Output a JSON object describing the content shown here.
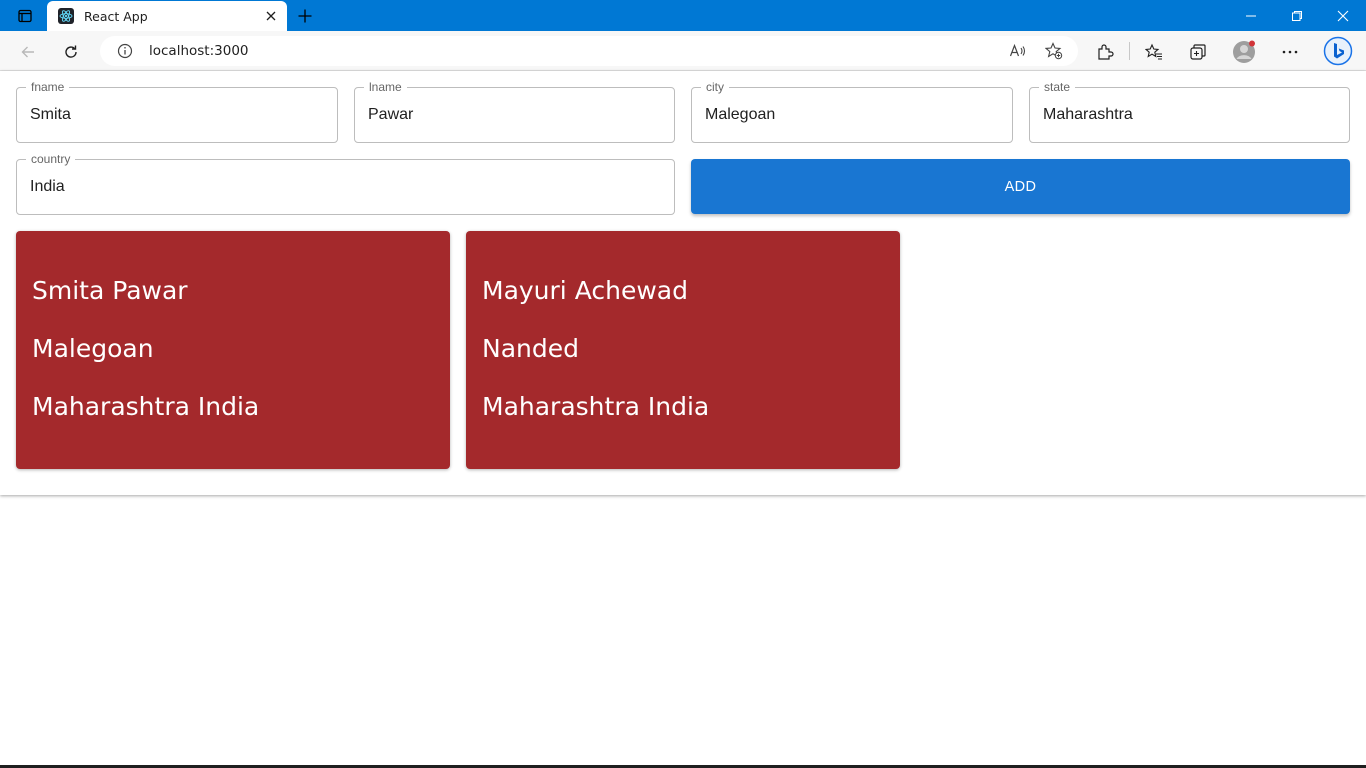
{
  "browser": {
    "tab_title": "React App",
    "url": "localhost:3000"
  },
  "form": {
    "fname": {
      "label": "fname",
      "value": "Smita"
    },
    "lname": {
      "label": "lname",
      "value": "Pawar"
    },
    "city": {
      "label": "city",
      "value": "Malegoan"
    },
    "state": {
      "label": "state",
      "value": "Maharashtra"
    },
    "country": {
      "label": "country",
      "value": "India"
    },
    "add_label": "ADD"
  },
  "cards": [
    {
      "name": "Smita Pawar",
      "city": "Malegoan",
      "region": "Maharashtra India"
    },
    {
      "name": "Mayuri Achewad",
      "city": "Nanded",
      "region": "Maharashtra India"
    }
  ],
  "colors": {
    "titlebar": "#0078d4",
    "add_button": "#1976d2",
    "card": "#a4292c"
  }
}
